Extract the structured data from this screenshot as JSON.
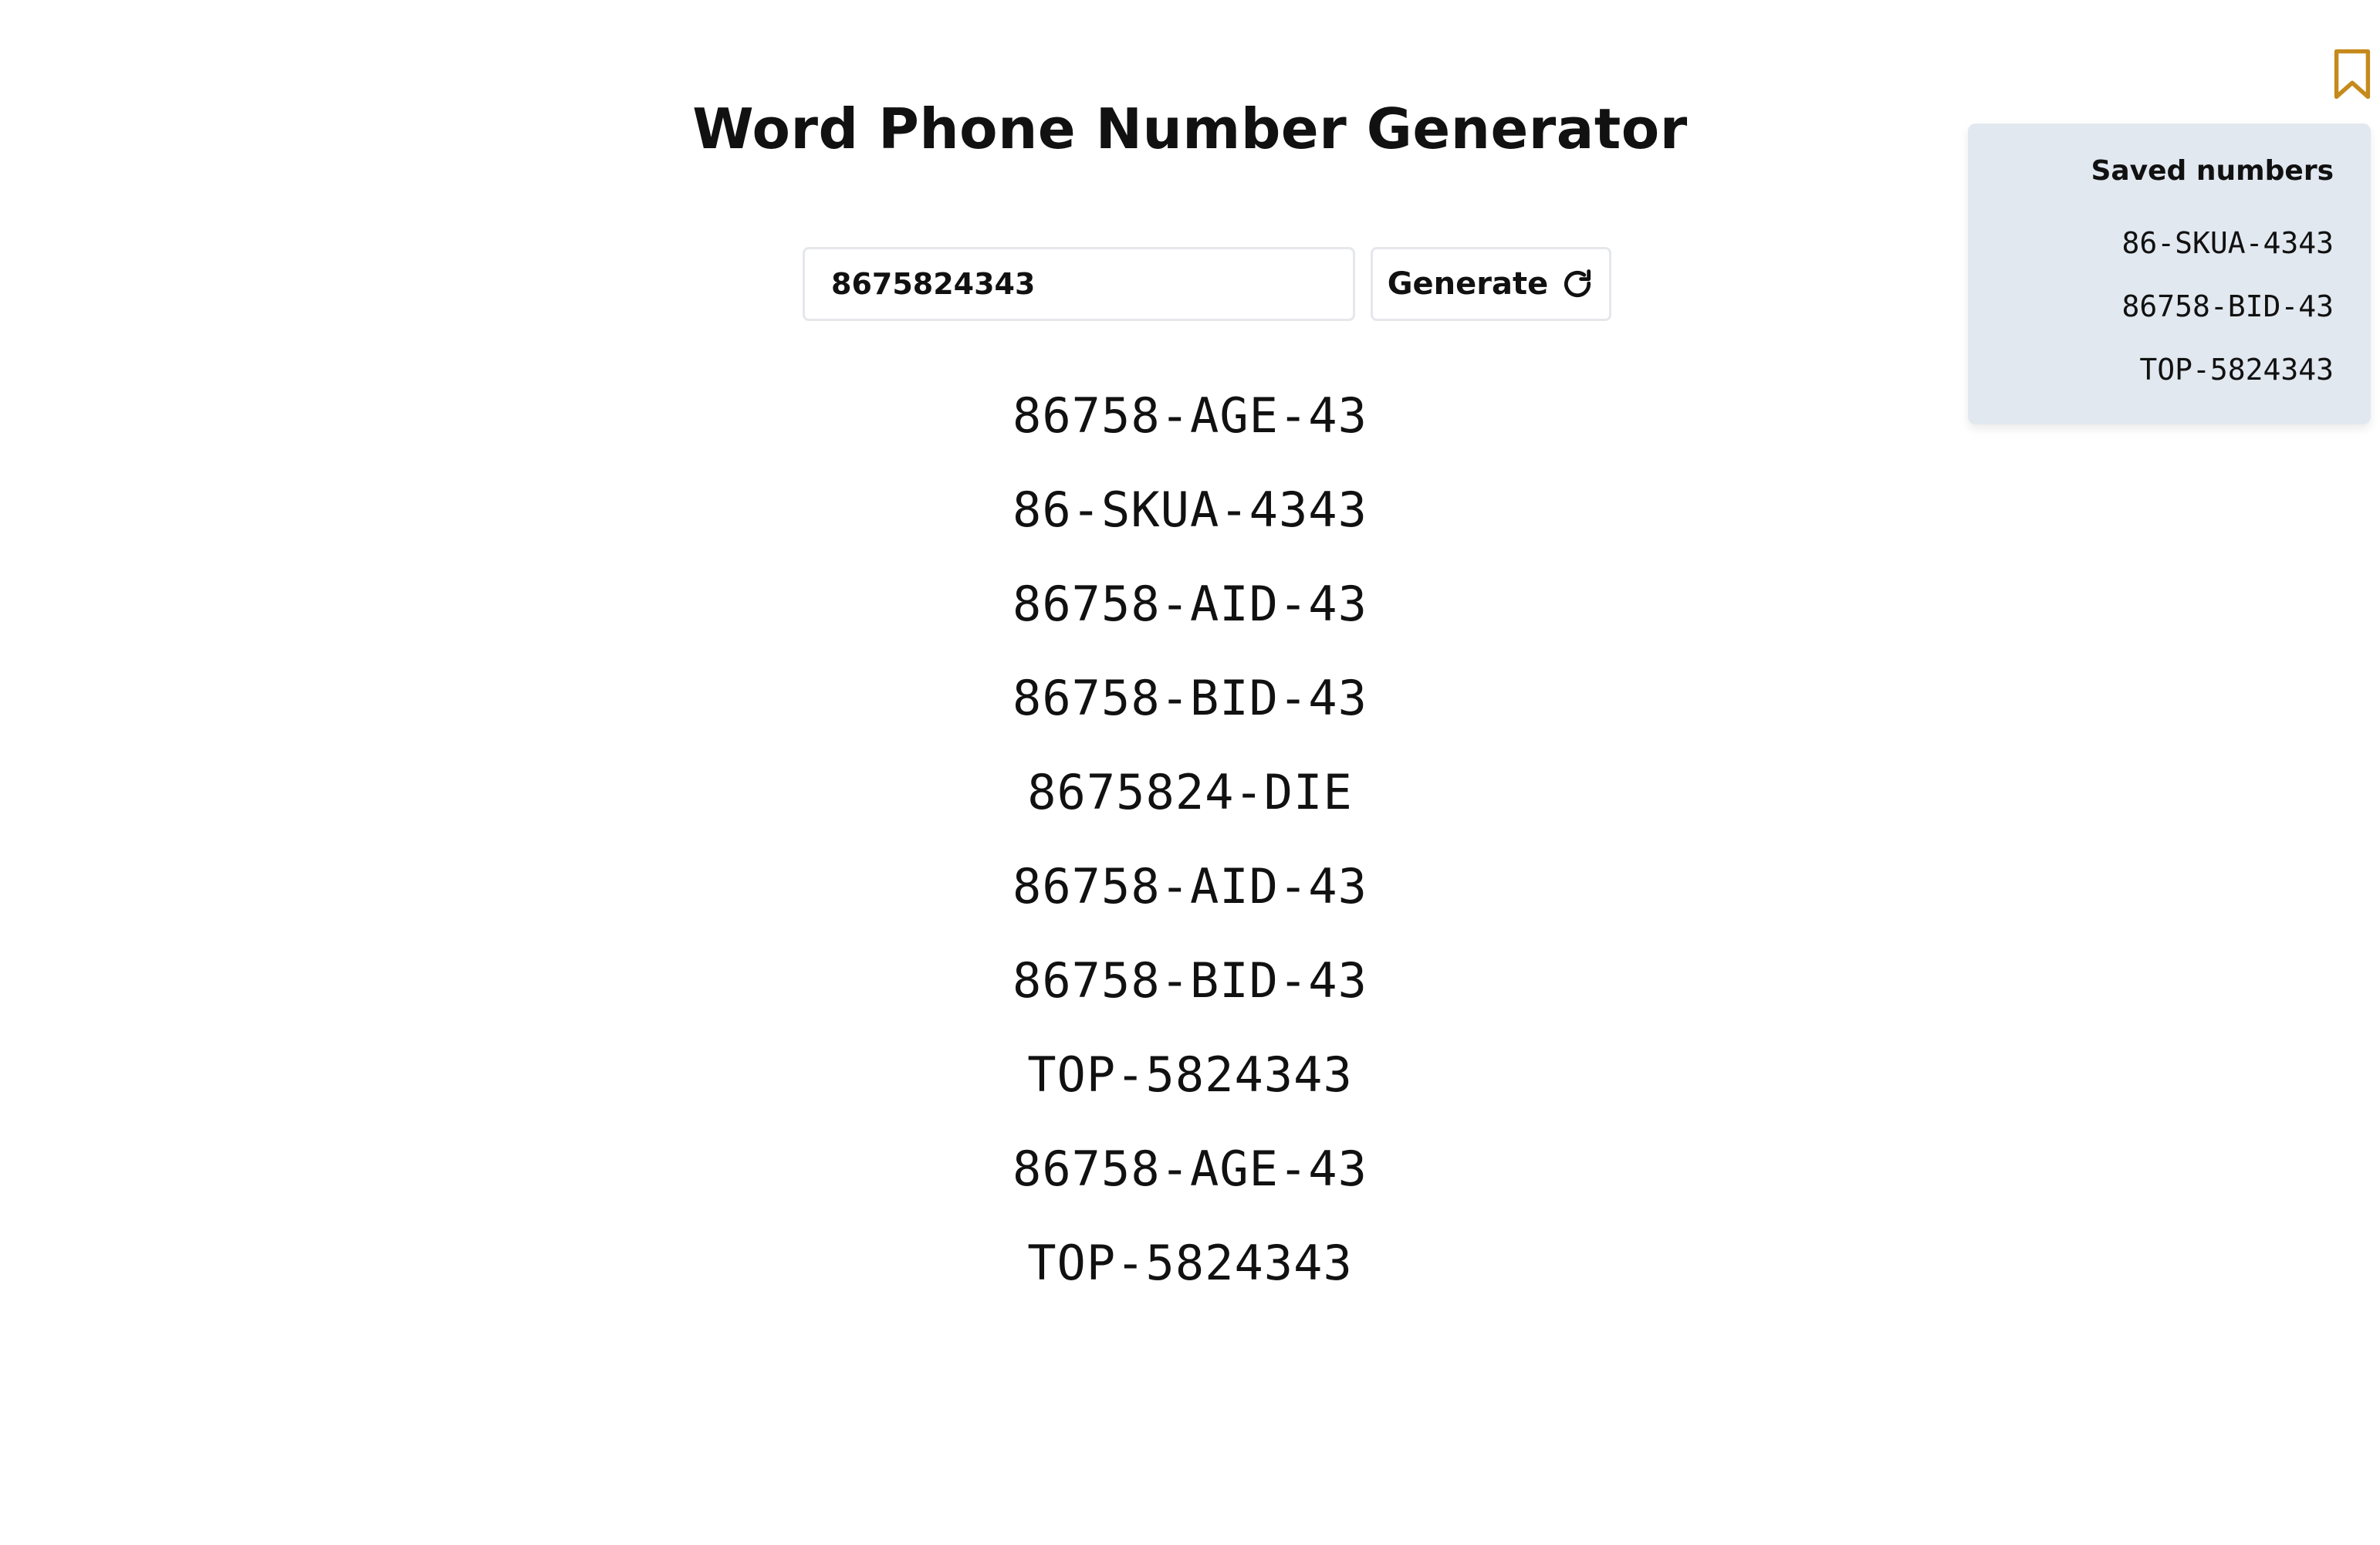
{
  "page": {
    "title": "Word Phone Number Generator"
  },
  "input": {
    "value": "8675824343"
  },
  "generate_button": {
    "label": "Generate",
    "icon": "refresh-icon"
  },
  "results": [
    "86758-AGE-43",
    "86-SKUA-4343",
    "86758-AID-43",
    "86758-BID-43",
    "8675824-DIE",
    "86758-AID-43",
    "86758-BID-43",
    "TOP-5824343",
    "86758-AGE-43",
    "TOP-5824343"
  ],
  "bookmark": {
    "icon": "bookmark-icon",
    "color": "#c58a1c"
  },
  "saved": {
    "title": "Saved numbers",
    "items": [
      "86-SKUA-4343",
      "86758-BID-43",
      "TOP-5824343"
    ],
    "background": "#e2e8f0"
  }
}
